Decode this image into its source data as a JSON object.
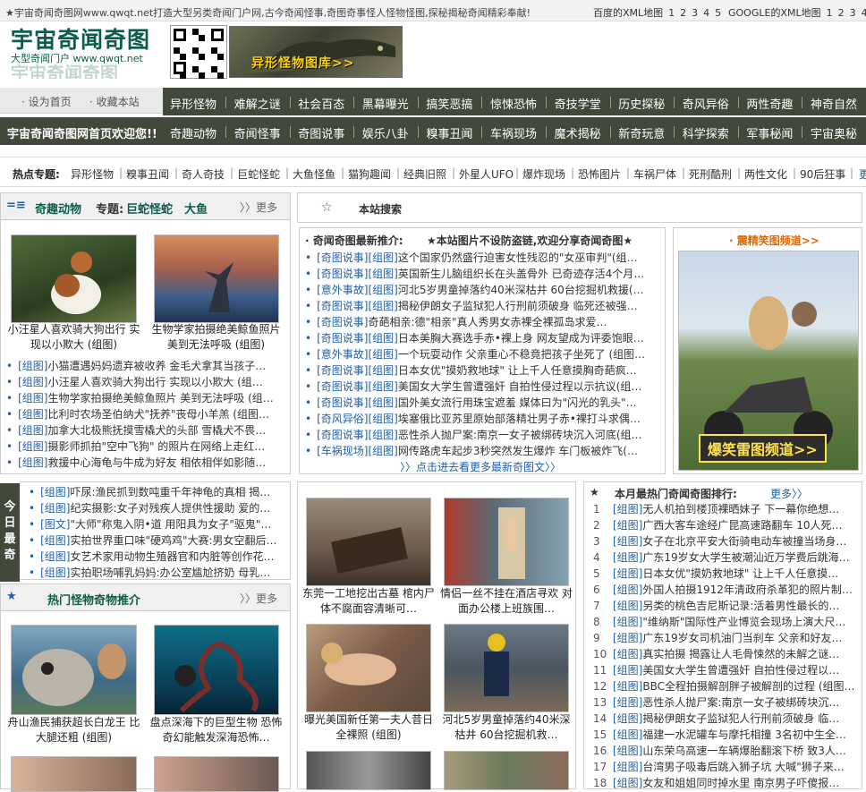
{
  "topbar": {
    "welcome": "★宇宙奇闻奇图网www.qwqt.net打造大型另类奇闻门户网,古今奇闻怪事,奇图奇事怪人怪物怪图,探秘揭秘奇闻精彩奉献!",
    "baidu_label": "百度的XML地图",
    "baidu_pages": [
      "1",
      "2",
      "3",
      "4",
      "5"
    ],
    "google_label": "GOOGLE的XML地图",
    "google_pages": [
      "1",
      "2",
      "3",
      "4",
      "5"
    ]
  },
  "logo": {
    "title": "宇宙奇闻奇图",
    "subtitle": "大型奇闻门户 www.qwqt.net"
  },
  "banner": {
    "text": "异形怪物图库>>"
  },
  "homebar": {
    "set_home": "· 设为首页",
    "favorite": "· 收藏本站"
  },
  "welcome": "宇宙奇闻奇图网首页欢迎您!!",
  "nav": {
    "row1": [
      "异形怪物",
      "难解之谜",
      "社会百态",
      "黑幕曝光",
      "搞笑恶搞",
      "惊悚恐怖",
      "奇技学堂",
      "历史探秘",
      "奇风异俗",
      "两性奇趣",
      "神奇自然"
    ],
    "row2": [
      "奇趣动物",
      "奇闻怪事",
      "奇图说事",
      "娱乐八卦",
      "糗事丑闻",
      "车祸现场",
      "魔术揭秘",
      "新奇玩意",
      "科学探索",
      "军事秘闻",
      "宇宙奥秘"
    ]
  },
  "hot": {
    "label": "热点专题:",
    "items": [
      "异形怪物",
      "糗事丑闻",
      "奇人奇技",
      "巨蛇怪蛇",
      "大鱼怪鱼",
      "猫狗趣闻",
      "经典旧照",
      "外星人UFO",
      "爆炸现场",
      "恐怖图片",
      "车祸尸体",
      "死刑酷刑",
      "两性文化",
      "90后狂事"
    ],
    "more": "更多→"
  },
  "animals": {
    "icon": "=≡",
    "title": "奇趣动物",
    "special_label": "专题:",
    "special1": "巨蛇怪蛇",
    "special2": "大鱼",
    "more": "〉〉更多",
    "photos": [
      {
        "caption": "小汪星人喜欢骑大狗出行 实现以小欺大 (组图)"
      },
      {
        "caption": "生物学家拍摄绝美鲸鱼照片 美到无法呼吸 (组图)"
      }
    ],
    "list_tag": "[组图]",
    "list": [
      "小猫遭遇妈妈遗弃被收养 金毛犬拿其当孩子…",
      "小汪星人喜欢骑大狗出行 实现以小欺大 (组…",
      "生物学家拍摄绝美鲸鱼照片 美到无法呼吸 (组…",
      "比利时农场圣伯纳犬\"抚养\"丧母小羊羔 (组图…",
      "加拿大北极熊抚摸雪橇犬的头部 雪橇犬不畏…",
      "摄影师抓拍\"空中飞狗\" 的照片在网络上走红…",
      "救援中心海龟与牛成为好友 相依相伴如影随…"
    ]
  },
  "search": {
    "icon": "☆",
    "title": "本站搜索"
  },
  "latest": {
    "title": "· 奇闻奇图最新推介:",
    "notice": "★本站图片不设防盗链,欢迎分享奇闻奇图★",
    "items": [
      {
        "cat": "[奇图说事]",
        "tag": "[组图]",
        "text": "这个国家仍然盛行迫害女性残忍的\"女巫审判\"(组…"
      },
      {
        "cat": "[奇图说事]",
        "tag": "[组图]",
        "text": "英国新生儿脑组织长在头盖骨外 已奇迹存活4个月…"
      },
      {
        "cat": "[意外事故]",
        "tag": "[组图]",
        "text": "河北5岁男童掉落约40米深枯井 60台挖掘机救援(…"
      },
      {
        "cat": "[奇图说事]",
        "tag": "[组图]",
        "text": "揭秘伊朗女子监狱犯人行刑前须破身 临死还被强…"
      },
      {
        "cat": "[奇图说事]",
        "tag": "",
        "text": "奇葩相亲:德\"相亲\"真人秀男女赤裸全裸孤岛求爱…"
      },
      {
        "cat": "[奇图说事]",
        "tag": "[组图]",
        "text": "日本美胸大赛选手赤•裸上身 网友望成为评委饱眼…"
      },
      {
        "cat": "[意外事故]",
        "tag": "[组图]",
        "text": "一个玩耍动作 父亲重心不稳竟把孩子坐死了 (组图…"
      },
      {
        "cat": "[奇图说事]",
        "tag": "[组图]",
        "text": "日本女优\"摸奶救地球\" 让上千人任意摸胸奇葩疯…"
      },
      {
        "cat": "[奇图说事]",
        "tag": "[组图]",
        "text": "美国女大学生曾遭强奸 自拍性侵过程以示抗议(组…"
      },
      {
        "cat": "[奇图说事]",
        "tag": "[组图]",
        "text": "国外美女流行用珠宝遮羞 媒体曰为\"闪光的乳头\"…"
      },
      {
        "cat": "[奇风异俗]",
        "tag": "[组图]",
        "text": "埃塞俄比亚苏里原始部落精壮男子赤•裸打斗求偶…"
      },
      {
        "cat": "[奇图说事]",
        "tag": "[组图]",
        "text": "恶性杀人抛尸案:南京一女子被绑砖块沉入河底(组…"
      },
      {
        "cat": "[车祸现场]",
        "tag": "[组图]",
        "text": "网传路虎车起步3秒突然发生爆炸 车门板被炸飞(…"
      }
    ],
    "more": "〉〉点击进去看更多最新奇图文〉〉"
  },
  "laugh": {
    "title": "· 震精笑图频道>>",
    "banner": "爆笑雷图频道>>"
  },
  "today": {
    "label": "今日最奇",
    "items": [
      {
        "tag": "[组图]",
        "text": "吓尿:渔民抓到数吨重千年神龟的真相 揭…"
      },
      {
        "tag": "[组图]",
        "text": "纪实摄影:女子对残疾人提供性援助 爱的…"
      },
      {
        "tag": "[图文]",
        "text": "\"大师\"称鬼入阴•道 用阳具为女子\"驱鬼\"…"
      },
      {
        "tag": "[组图]",
        "text": "实拍世界重口味\"硬鸡鸡\"大赛:男女空翻后…"
      },
      {
        "tag": "[组图]",
        "text": "女艺术家用动物生殖器官和内脏等创作花…"
      },
      {
        "tag": "[组图]",
        "text": "实拍职场哺乳妈妈:办公室尴尬挤奶 母乳…"
      }
    ]
  },
  "monsters": {
    "icon": "★",
    "title": "热门怪物奇物推介",
    "more": "〉〉更多",
    "photos": [
      {
        "caption": "舟山渔民捕获超长白龙王 比大腿还粗 (组图)"
      },
      {
        "caption": "盘点深海下的巨型生物 恐怖奇幻能触发深海恐怖…"
      }
    ]
  },
  "middle_photos": [
    {
      "caption": "东莞一工地挖出古墓 棺内尸体不腐面容清晰可…"
    },
    {
      "caption": "情侣一丝不挂在酒店寻欢 对面办公楼上班族围…"
    },
    {
      "caption": "曝光美国新任第一夫人昔日全裸照 (组图)"
    },
    {
      "caption": "河北5岁男童掉落约40米深枯井 60台挖掘机救…"
    }
  ],
  "ranking": {
    "icon": "★",
    "title": "本月最热门奇闻奇图排行:",
    "more": "更多〉〉",
    "items": [
      {
        "n": "1",
        "tag": "[组图]",
        "text": "无人机拍到楼顶裸晒妹子 下一幕你绝想…"
      },
      {
        "n": "2",
        "tag": "[组图]",
        "text": "广西大客车途经广昆高速路翻车 10人死…"
      },
      {
        "n": "3",
        "tag": "[组图]",
        "text": "女子在北京平安大街骑电动车被撞当场身…"
      },
      {
        "n": "4",
        "tag": "[组图]",
        "text": "广东19岁女大学生被潮汕近万学费后跳海…"
      },
      {
        "n": "5",
        "tag": "[组图]",
        "text": "日本女优\"摸奶救地球\" 让上千人任意摸…"
      },
      {
        "n": "6",
        "tag": "[组图]",
        "text": "外国人拍摄1912年清政府杀革犯的照片制…"
      },
      {
        "n": "7",
        "tag": "[组图]",
        "text": "另类的桃色吉尼斯记录:活着男性最长的…"
      },
      {
        "n": "8",
        "tag": "[组图]",
        "text": "\"维纳斯\"国际性产业博览会现场上演大尺…"
      },
      {
        "n": "9",
        "tag": "[组图]",
        "text": "广东19岁女司机油门当刹车 父亲和好友…"
      },
      {
        "n": "10",
        "tag": "[组图]",
        "text": "真实拍摄 揭露让人毛骨悚然的未解之谜…"
      },
      {
        "n": "11",
        "tag": "[组图]",
        "text": "美国女大学生曾遭强奸 自拍性侵过程以…"
      },
      {
        "n": "12",
        "tag": "[组图]",
        "text": "BBC全程拍摄解剖胖子被解剖的过程 (组图…"
      },
      {
        "n": "13",
        "tag": "[组图]",
        "text": "恶性杀人抛尸案:南京一女子被绑砖块沉…"
      },
      {
        "n": "14",
        "tag": "[组图]",
        "text": "揭秘伊朗女子监狱犯人行刑前须破身 临…"
      },
      {
        "n": "15",
        "tag": "[组图]",
        "text": "福建一水泥罐车与摩托相撞 3名初中生全…"
      },
      {
        "n": "16",
        "tag": "[组图]",
        "text": "山东荣乌高速一车辆爆胎翻滚下桥 致3人…"
      },
      {
        "n": "17",
        "tag": "[组图]",
        "text": "台湾男子吸毒后跳入狮子坑 大喊\"狮子来…"
      },
      {
        "n": "18",
        "tag": "[组图]",
        "text": "女友和姐姐同时掉水里 南京男子吓傻报…"
      }
    ]
  }
}
